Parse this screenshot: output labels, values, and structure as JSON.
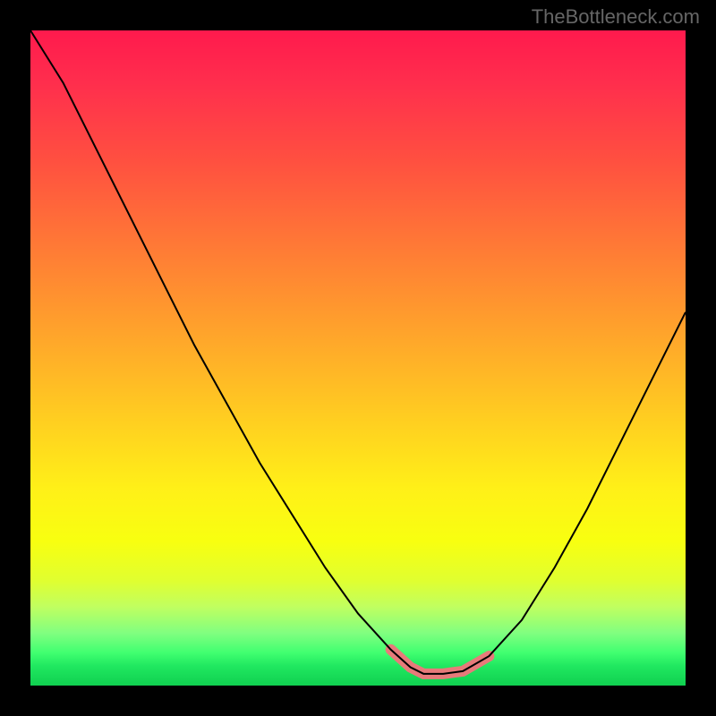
{
  "watermark": "TheBottleneck.com",
  "chart_data": {
    "type": "line",
    "title": "",
    "xlabel": "",
    "ylabel": "",
    "x": [
      0.0,
      0.05,
      0.1,
      0.15,
      0.2,
      0.25,
      0.3,
      0.35,
      0.4,
      0.45,
      0.5,
      0.55,
      0.58,
      0.6,
      0.63,
      0.66,
      0.7,
      0.75,
      0.8,
      0.85,
      0.9,
      0.95,
      1.0
    ],
    "y": [
      1.0,
      0.92,
      0.82,
      0.72,
      0.62,
      0.52,
      0.43,
      0.34,
      0.26,
      0.18,
      0.11,
      0.055,
      0.028,
      0.018,
      0.018,
      0.022,
      0.045,
      0.1,
      0.18,
      0.27,
      0.37,
      0.47,
      0.57
    ],
    "highlight_band": {
      "x": [
        0.55,
        0.58,
        0.6,
        0.63,
        0.66,
        0.7
      ],
      "y": [
        0.055,
        0.028,
        0.018,
        0.018,
        0.022,
        0.045
      ]
    },
    "xlim": [
      0,
      1
    ],
    "ylim": [
      0,
      1
    ],
    "background": "gradient-red-yellow-green",
    "legend": false,
    "grid": false
  }
}
